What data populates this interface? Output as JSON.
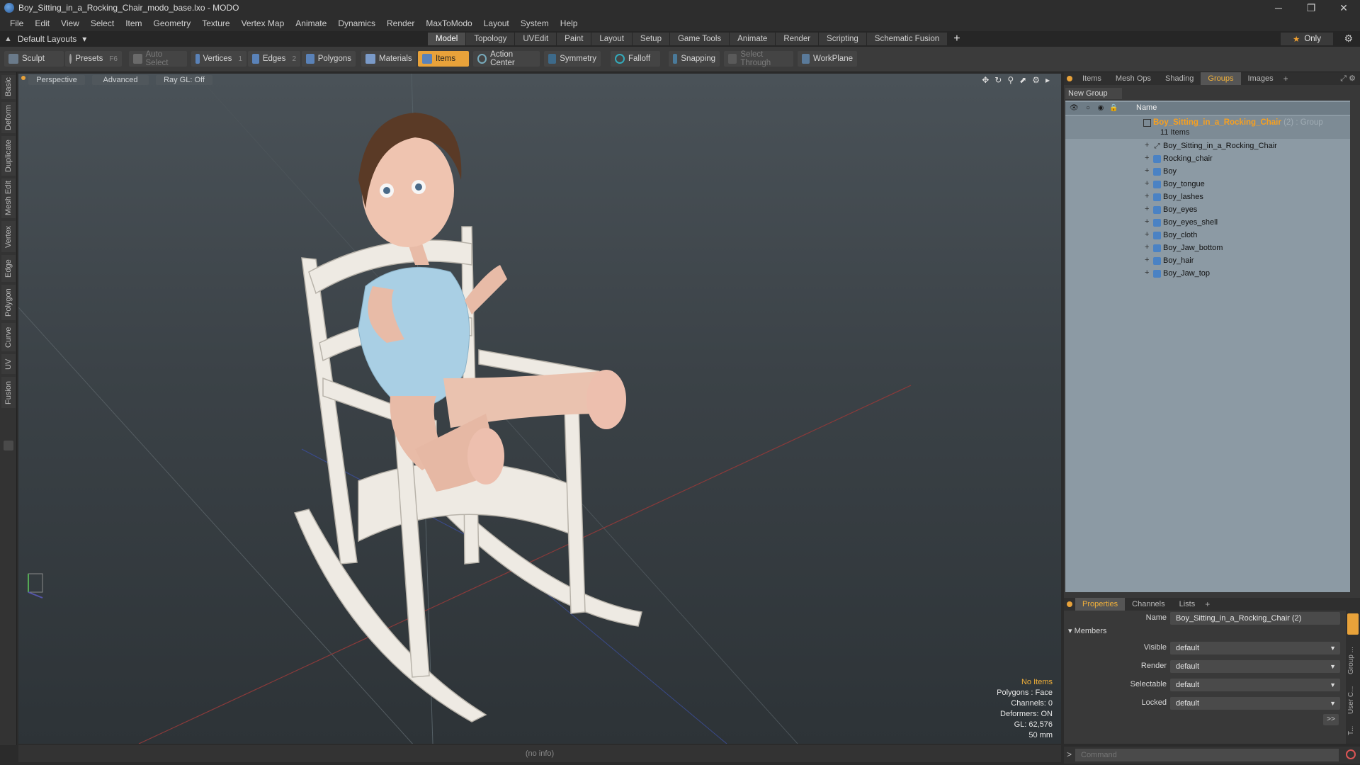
{
  "window": {
    "title": "Boy_Sitting_in_a_Rocking_Chair_modo_base.lxo - MODO",
    "minimize": "─",
    "restore": "❐",
    "close": "✕"
  },
  "menu": [
    "File",
    "Edit",
    "View",
    "Select",
    "Item",
    "Geometry",
    "Texture",
    "Vertex Map",
    "Animate",
    "Dynamics",
    "Render",
    "MaxToModo",
    "Layout",
    "System",
    "Help"
  ],
  "layouts": {
    "label": "Default Layouts"
  },
  "mode_tabs": [
    "Model",
    "Topology",
    "UVEdit",
    "Paint",
    "Layout",
    "Setup",
    "Game Tools",
    "Animate",
    "Render",
    "Scripting",
    "Schematic Fusion"
  ],
  "mode_active": "Model",
  "only_label": "Only",
  "toolbar": {
    "sculpt": "Sculpt",
    "presets": "Presets",
    "presets_hotkey": "F6",
    "auto_select": "Auto Select",
    "vertices": "Vertices",
    "vertices_hotkey": "1",
    "edges": "Edges",
    "edges_hotkey": "2",
    "polygons": "Polygons",
    "materials": "Materials",
    "items": "Items",
    "action_center": "Action Center",
    "symmetry": "Symmetry",
    "falloff": "Falloff",
    "snapping": "Snapping",
    "select_through": "Select Through",
    "workplane": "WorkPlane"
  },
  "left_tabs": [
    "Basic",
    "Deform",
    "Duplicate",
    "Mesh Edit",
    "Vertex",
    "Edge",
    "Polygon",
    "Curve",
    "UV",
    "Fusion"
  ],
  "viewport": {
    "view": "Perspective",
    "shading": "Advanced",
    "raygl": "Ray GL: Off",
    "info": {
      "selection": "No Items",
      "polygons": "Polygons : Face",
      "channels": "Channels: 0",
      "deformers": "Deformers: ON",
      "gl": "GL: 62,576",
      "lens": "50 mm"
    },
    "status": "(no info)"
  },
  "right_panel": {
    "tabs": [
      "Items",
      "Mesh Ops",
      "Shading",
      "Groups",
      "Images"
    ],
    "active_tab": "Groups",
    "new_group": "New Group",
    "name_header": "Name",
    "group": {
      "name": "Boy_Sitting_in_a_Rocking_Chair",
      "suffix": "(2) : Group",
      "count": "11 Items",
      "children": [
        "Boy_Sitting_in_a_Rocking_Chair",
        "Rocking_chair",
        "Boy",
        "Boy_tongue",
        "Boy_lashes",
        "Boy_eyes",
        "Boy_eyes_shell",
        "Boy_cloth",
        "Boy_Jaw_bottom",
        "Boy_hair",
        "Boy_Jaw_top"
      ]
    }
  },
  "properties": {
    "tabs": [
      "Properties",
      "Channels",
      "Lists"
    ],
    "active_tab": "Properties",
    "name_label": "Name",
    "name_value": "Boy_Sitting_in_a_Rocking_Chair (2)",
    "members": "Members",
    "visible_label": "Visible",
    "visible_value": "default",
    "render_label": "Render",
    "render_value": "default",
    "selectable_label": "Selectable",
    "selectable_value": "default",
    "locked_label": "Locked",
    "locked_value": "default",
    "expand": ">>"
  },
  "command": {
    "placeholder": "Command"
  },
  "colors": {
    "accent": "#e8a23a",
    "group_name": "#f7a020"
  }
}
